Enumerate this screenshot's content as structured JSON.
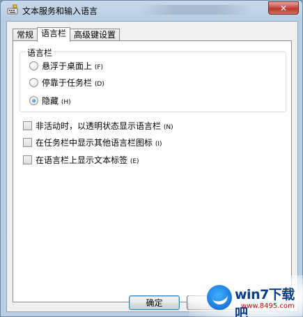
{
  "window": {
    "title": "文本服务和输入语言",
    "close_label": "✕"
  },
  "tabs": [
    {
      "label": "常规"
    },
    {
      "label": "语言栏"
    },
    {
      "label": "高级键设置"
    }
  ],
  "active_tab": 1,
  "language_bar": {
    "group_label": "语言栏",
    "options": [
      {
        "label": "悬浮于桌面上",
        "hotkey": "(F)",
        "checked": false
      },
      {
        "label": "停靠于任务栏",
        "hotkey": "(D)",
        "checked": false
      },
      {
        "label": "隐藏",
        "hotkey": "(H)",
        "checked": true
      }
    ]
  },
  "checkboxes": [
    {
      "label": "非活动时，以透明状态显示语言栏",
      "hotkey": "(N)",
      "checked": false
    },
    {
      "label": "在任务栏中显示其他语言栏图标",
      "hotkey": "(I)",
      "checked": false
    },
    {
      "label": "在语言栏上显示文本标签",
      "hotkey": "(E)",
      "checked": false
    }
  ],
  "buttons": {
    "ok": "确定"
  },
  "watermark": {
    "site": "win7下载吧",
    "url": "www.8495.com"
  },
  "colors": {
    "accent": "#1a5ea8",
    "close": "#c75050"
  }
}
